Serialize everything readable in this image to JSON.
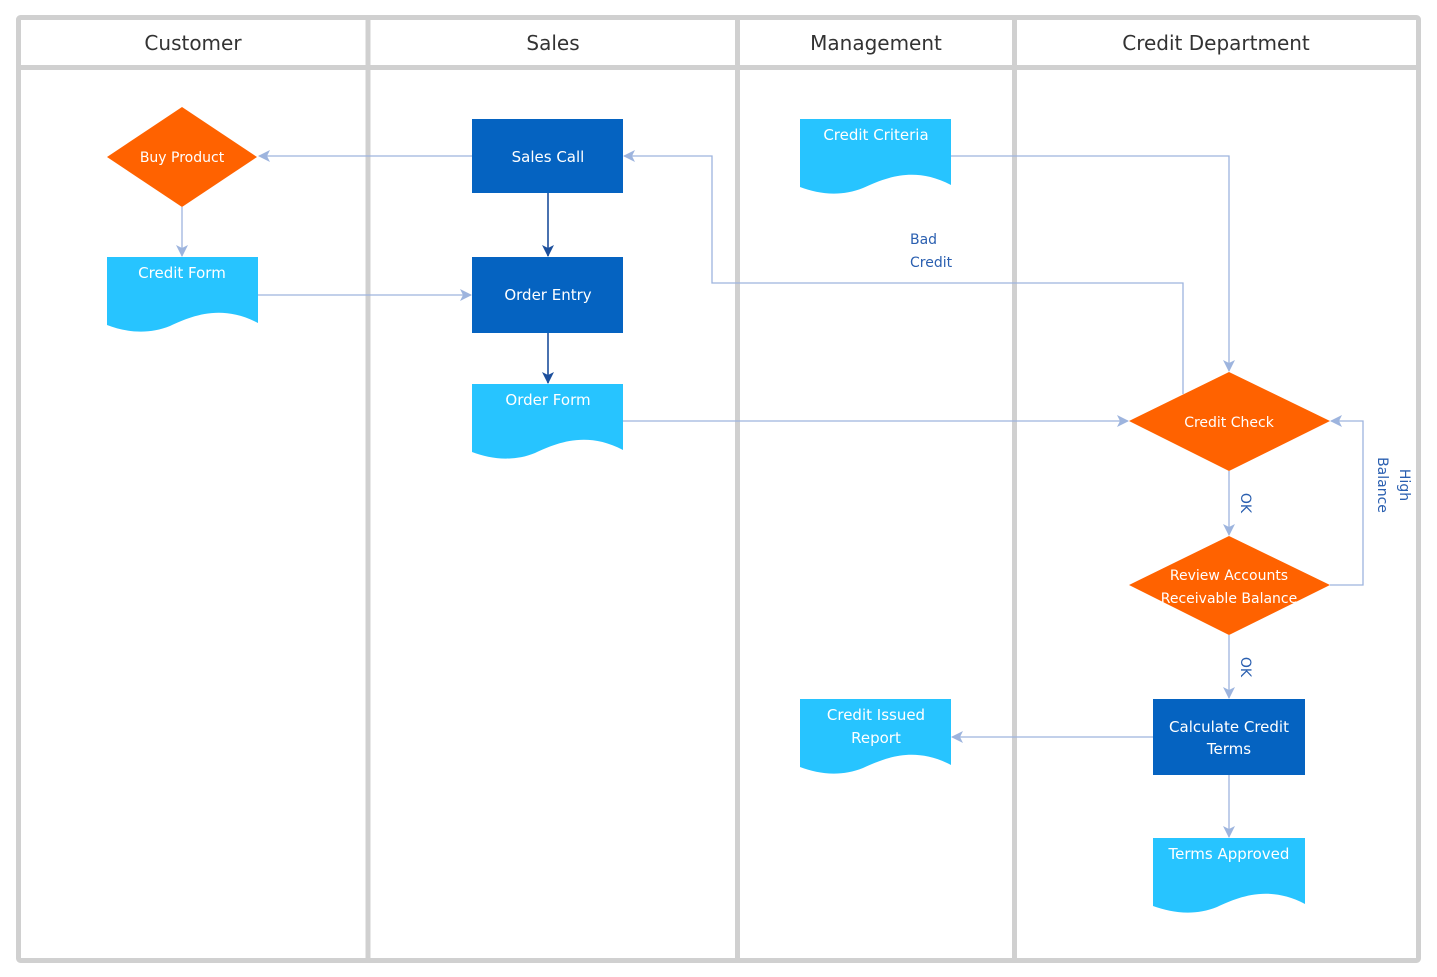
{
  "diagram": {
    "type": "cross-functional-flowchart",
    "colors": {
      "decision": "#FF6200",
      "process": "#0563C1",
      "document": "#27C4FF",
      "connector": "#9DB4DE",
      "connector_dark": "#1C4F9C",
      "label_text": "#2A5FB0",
      "lane_border": "#D0D0D0"
    },
    "lanes": [
      {
        "id": "customer",
        "title": "Customer"
      },
      {
        "id": "sales",
        "title": "Sales"
      },
      {
        "id": "management",
        "title": "Management"
      },
      {
        "id": "credit",
        "title": "Credit Department"
      }
    ],
    "nodes": {
      "buy_product": {
        "lane": "customer",
        "shape": "decision",
        "lines": [
          "Buy Product"
        ]
      },
      "credit_form": {
        "lane": "customer",
        "shape": "document",
        "lines": [
          "Credit Form"
        ]
      },
      "sales_call": {
        "lane": "sales",
        "shape": "process",
        "lines": [
          "Sales Call"
        ]
      },
      "order_entry": {
        "lane": "sales",
        "shape": "process",
        "lines": [
          "Order Entry"
        ]
      },
      "order_form": {
        "lane": "sales",
        "shape": "document",
        "lines": [
          "Order Form"
        ]
      },
      "credit_criteria": {
        "lane": "management",
        "shape": "document",
        "lines": [
          "Credit Criteria"
        ]
      },
      "credit_issued_report": {
        "lane": "management",
        "shape": "document",
        "lines": [
          "Credit Issued",
          "Report"
        ]
      },
      "credit_check": {
        "lane": "credit",
        "shape": "decision",
        "lines": [
          "Credit Check"
        ]
      },
      "review_ar": {
        "lane": "credit",
        "shape": "decision",
        "lines": [
          "Review Accounts",
          "Receivable Balance"
        ]
      },
      "calc_terms": {
        "lane": "credit",
        "shape": "process",
        "lines": [
          "Calculate Credit",
          "Terms"
        ]
      },
      "terms_approved": {
        "lane": "credit",
        "shape": "document",
        "lines": [
          "Terms Approved"
        ]
      }
    },
    "edges": [
      {
        "from": "sales_call",
        "to": "buy_product",
        "label": ""
      },
      {
        "from": "buy_product",
        "to": "credit_form",
        "label": ""
      },
      {
        "from": "credit_form",
        "to": "order_entry",
        "label": ""
      },
      {
        "from": "sales_call",
        "to": "order_entry",
        "label": ""
      },
      {
        "from": "order_entry",
        "to": "order_form",
        "label": ""
      },
      {
        "from": "order_form",
        "to": "credit_check",
        "label": ""
      },
      {
        "from": "credit_criteria",
        "to": "credit_check",
        "label": ""
      },
      {
        "from": "credit_check",
        "to": "sales_call",
        "label": "Bad Credit"
      },
      {
        "from": "credit_check",
        "to": "review_ar",
        "label": "OK"
      },
      {
        "from": "review_ar",
        "to": "credit_check",
        "label": "High Balance"
      },
      {
        "from": "review_ar",
        "to": "calc_terms",
        "label": "OK"
      },
      {
        "from": "calc_terms",
        "to": "credit_issued_report",
        "label": ""
      },
      {
        "from": "calc_terms",
        "to": "terms_approved",
        "label": ""
      }
    ],
    "edge_labels": {
      "bad_credit": [
        "Bad",
        "Credit"
      ],
      "ok_1": "OK",
      "ok_2": "OK",
      "high_balance": [
        "High",
        "Balance"
      ]
    }
  }
}
